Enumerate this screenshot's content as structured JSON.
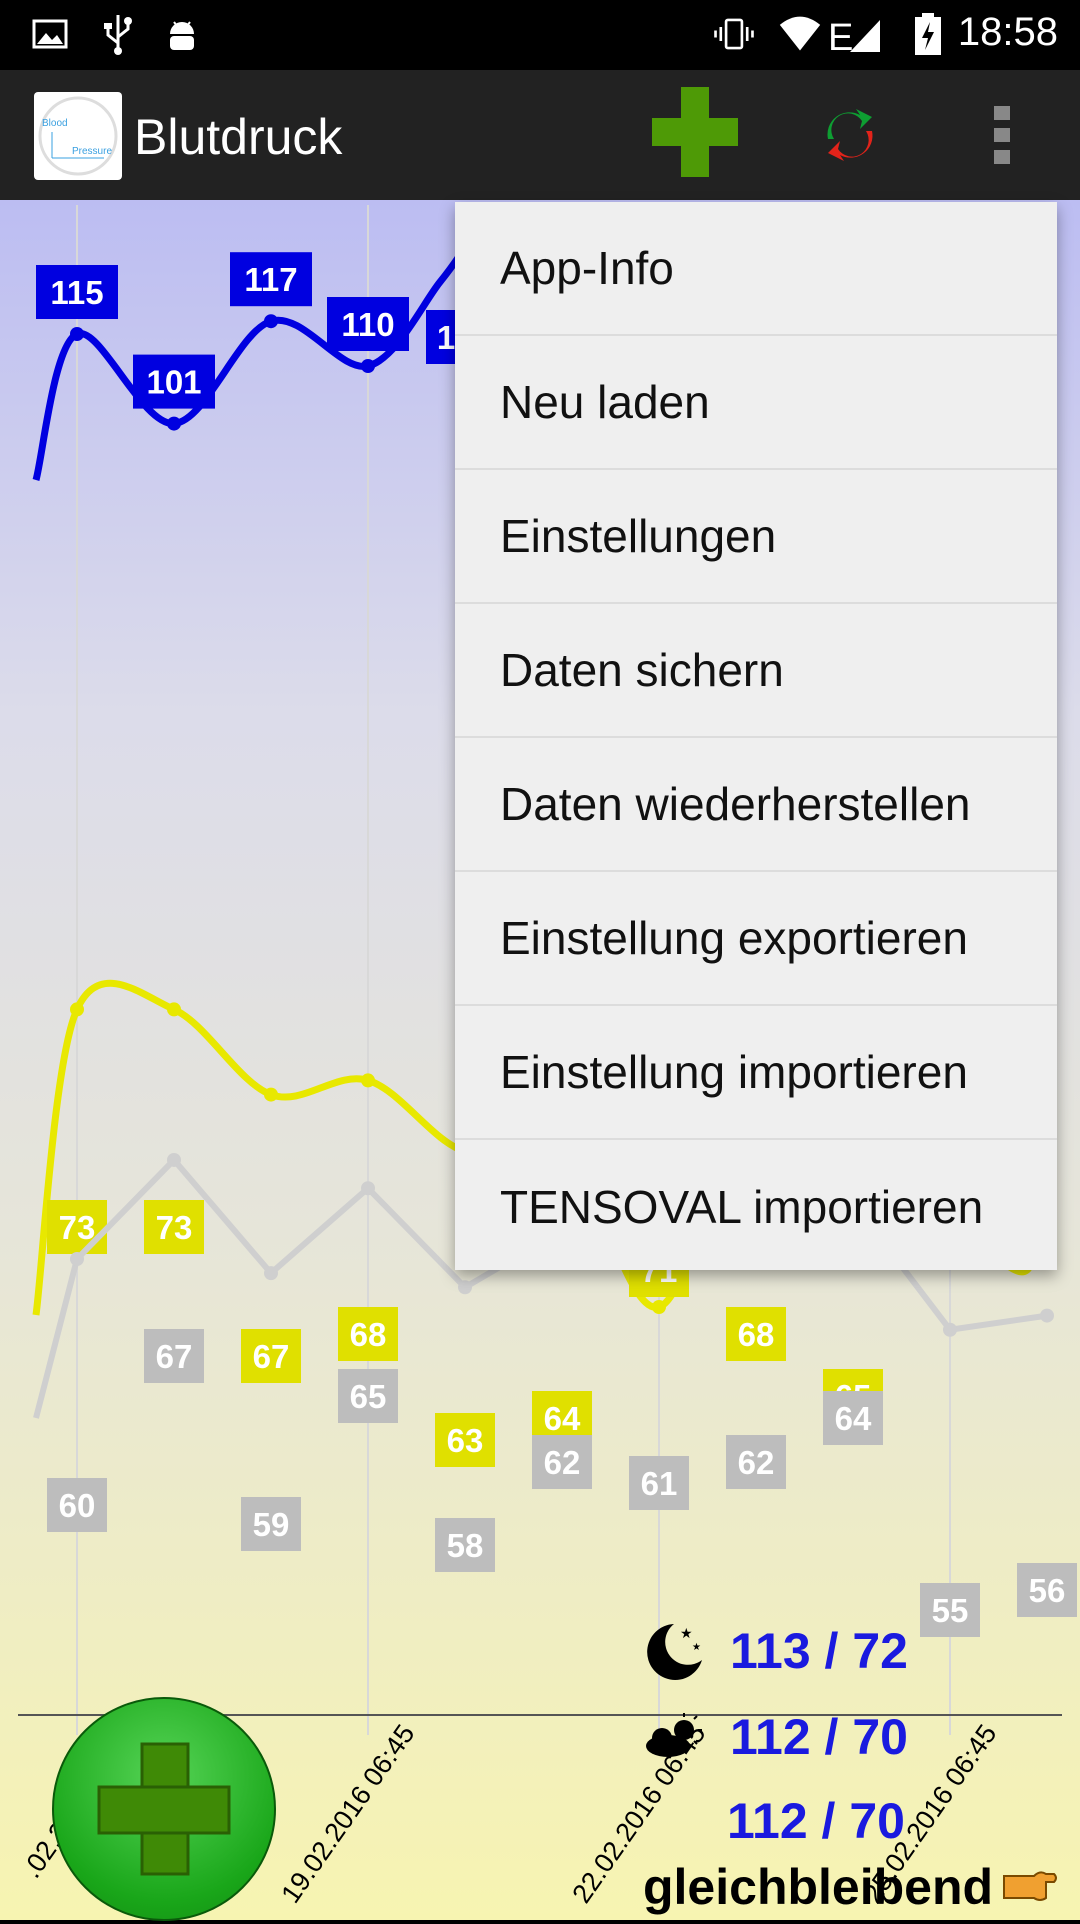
{
  "status_bar": {
    "time": "18:58",
    "icons": [
      "image-icon",
      "usb-icon",
      "android-debug-icon",
      "vibrate-icon",
      "wifi-icon",
      "signal-e-icon",
      "battery-charging-icon"
    ]
  },
  "app_bar": {
    "title": "Blutdruck",
    "logo_text_1": "Blood",
    "logo_text_2": "Pressure",
    "actions": [
      "add-icon",
      "sync-icon",
      "overflow-menu-icon"
    ],
    "accent": "#4e9a06"
  },
  "menu": {
    "items": [
      {
        "label": "App-Info"
      },
      {
        "label": "Neu laden"
      },
      {
        "label": "Einstellungen"
      },
      {
        "label": "Daten sichern"
      },
      {
        "label": "Daten wiederherstellen"
      },
      {
        "label": "Einstellung exportieren"
      },
      {
        "label": "Einstellung importieren"
      },
      {
        "label": "TENSOVAL importieren"
      }
    ]
  },
  "stats": {
    "night": "113 / 72",
    "day": "112 / 70",
    "total": "112 / 70",
    "trend": "gleichbleibend"
  },
  "chart_data": {
    "type": "line",
    "x_labels": [
      "19.02.2016 06:45",
      "22.02.2016 06:45",
      "25.02.2016 06:45"
    ],
    "x_labels_partial": [
      ".02.2"
    ],
    "series": [
      {
        "color": "#0000e0",
        "values": [
          115,
          101,
          117,
          110,
          1
        ]
      },
      {
        "color": "#e8e800",
        "values": [
          73,
          73,
          67,
          68,
          63,
          64,
          71,
          68,
          65
        ]
      },
      {
        "color": "#c0c0c0",
        "values": [
          60,
          67,
          59,
          65,
          58,
          62,
          61,
          62,
          64,
          55,
          56
        ]
      }
    ]
  }
}
